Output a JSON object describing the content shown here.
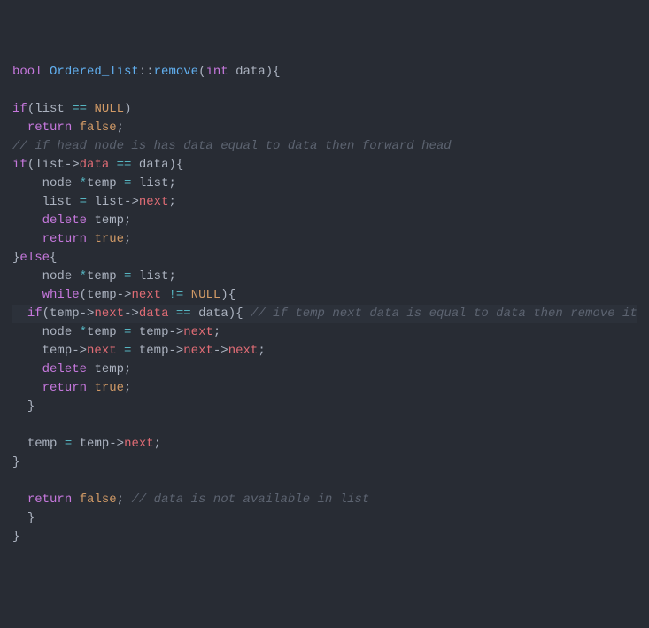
{
  "code": {
    "t_bool": "bool",
    "t_int": "int",
    "cls": "Ordered_list",
    "fn": "remove",
    "p_data": "data",
    "kw_if": "if",
    "kw_return": "return",
    "kw_else": "else",
    "kw_while": "while",
    "kw_delete": "delete",
    "kw_true": "true",
    "kw_false": "false",
    "null": "NULL",
    "id_list": "list",
    "id_node": "node",
    "id_temp": "temp",
    "prop_data": "data",
    "prop_next": "next",
    "op_scope": "::",
    "op_eq": "==",
    "op_neq": "!=",
    "op_assign": "=",
    "op_arrow": "->",
    "op_star": "*",
    "cmt_head": "// if head node is has data equal to data then forward head",
    "cmt_remove": "// if temp next data is equal to data then remove it",
    "cmt_na": "// data is not available in list",
    "lp": "(",
    "rp": ")",
    "lb": "{",
    "rb": "}",
    "semi": ";"
  }
}
